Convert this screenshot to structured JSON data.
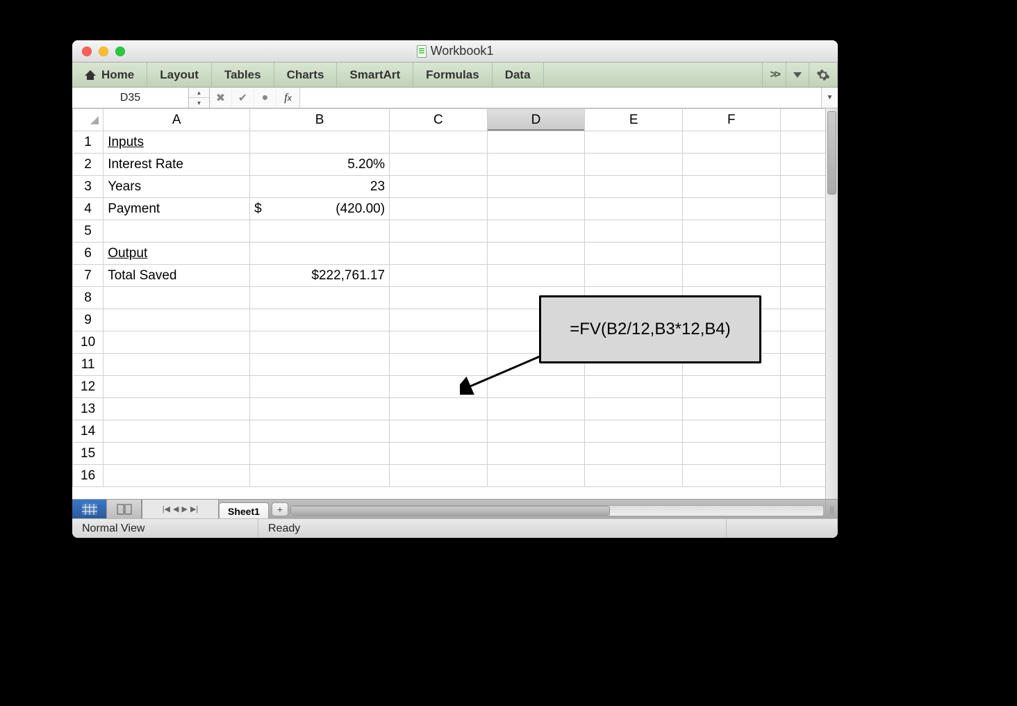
{
  "window": {
    "title": "Workbook1"
  },
  "ribbon": {
    "tabs": [
      "Home",
      "Layout",
      "Tables",
      "Charts",
      "SmartArt",
      "Formulas",
      "Data"
    ],
    "expand_label": ">>"
  },
  "formula_bar": {
    "name_box": "D35",
    "fx_label": "fx",
    "formula": ""
  },
  "columns": [
    "A",
    "B",
    "C",
    "D",
    "E",
    "F"
  ],
  "selected_column": "D",
  "row_count": 16,
  "cells": {
    "A1": "Inputs",
    "A2": "Interest Rate",
    "B2": "5.20%",
    "A3": "Years",
    "B3": "23",
    "A4": "Payment",
    "B4_currency": "$",
    "B4_value": "(420.00)",
    "A6": "Output",
    "A7": "Total Saved",
    "B7": "$222,761.17"
  },
  "callout": {
    "text": "=FV(B2/12,B3*12,B4)"
  },
  "sheet_tabs": {
    "active": "Sheet1",
    "add_label": "+"
  },
  "status_bar": {
    "view_mode": "Normal View",
    "status": "Ready"
  }
}
